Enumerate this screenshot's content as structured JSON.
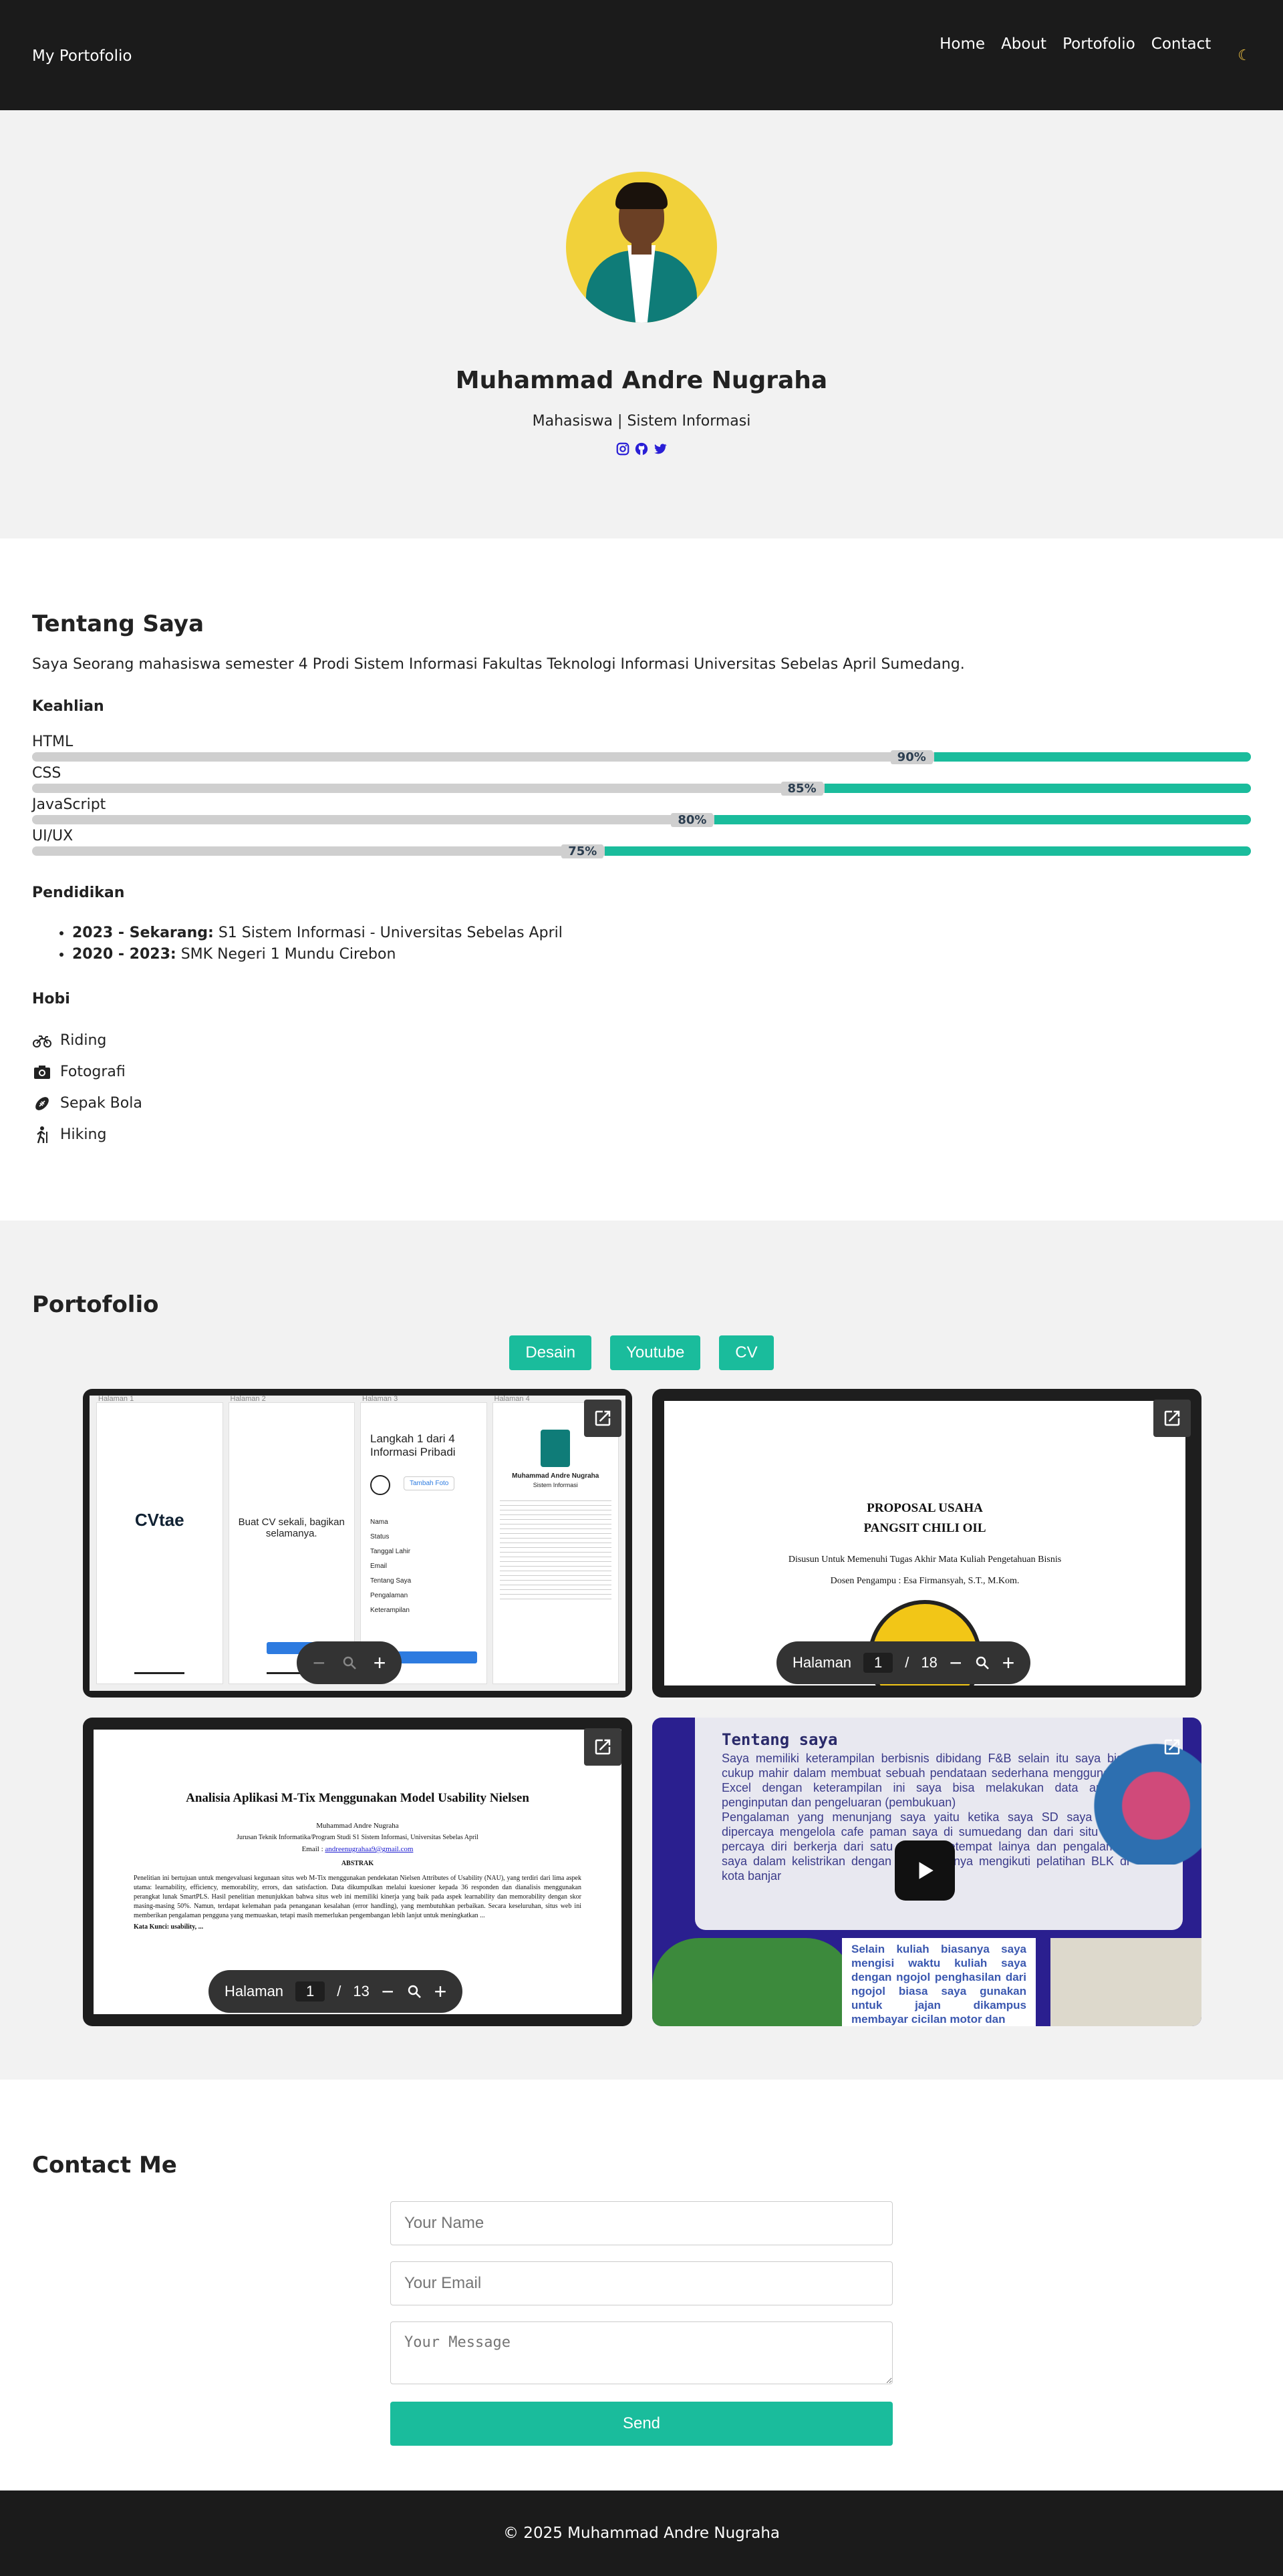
{
  "nav": {
    "brand": "My Portofolio",
    "links": [
      "Home",
      "About",
      "Portofolio",
      "Contact"
    ],
    "theme_icon": "moon-icon"
  },
  "hero": {
    "name": "Muhammad Andre Nugraha",
    "subtitle": "Mahasiswa | Sistem Informasi",
    "social": [
      "instagram-icon",
      "github-icon",
      "twitter-icon"
    ]
  },
  "about": {
    "title": "Tentang Saya",
    "intro": "Saya Seorang mahasiswa semester 4 Prodi Sistem Informasi Fakultas Teknologi Informasi Universitas Sebelas April Sumedang.",
    "skills_title": "Keahlian",
    "skills": [
      {
        "name": "HTML",
        "percent": 90,
        "label": "90%"
      },
      {
        "name": "CSS",
        "percent": 85,
        "label": "85%"
      },
      {
        "name": "JavaScript",
        "percent": 80,
        "label": "80%"
      },
      {
        "name": "UI/UX",
        "percent": 75,
        "label": "75%"
      }
    ],
    "education_title": "Pendidikan",
    "education": [
      {
        "years": "2023 - Sekarang:",
        "text": " S1 Sistem Informasi - Universitas Sebelas April"
      },
      {
        "years": "2020 - 2023:",
        "text": " SMK Negeri 1 Mundu Cirebon"
      }
    ],
    "hobbies_title": "Hobi",
    "hobbies": [
      "Riding",
      "Fotografi",
      "Sepak Bola",
      "Hiking"
    ]
  },
  "portfolio": {
    "title": "Portofolio",
    "filters": [
      "Desain",
      "Youtube",
      "CV"
    ],
    "card1": {
      "pages": [
        "Halaman 1",
        "Halaman 2",
        "Halaman 3",
        "Halaman 4"
      ],
      "logo": "CVtae",
      "tagline": "Buat CV sekali, bagikan selamanya.",
      "step_title": "Langkah 1 dari 4 Informasi Pribadi",
      "add_photo": "Tambah Foto",
      "fields": [
        "Nama",
        "Status",
        "Tanggal Lahir",
        "Email",
        "Tentang Saya",
        "Pengalaman",
        "Keterampilan"
      ],
      "profile_name": "Muhammad Andre Nugraha",
      "profile_role": "Sistem Informasi"
    },
    "card2": {
      "title1": "PROPOSAL USAHA",
      "title2": "PANGSIT CHILI OIL",
      "line1": "Disusun Untuk Memenuhi Tugas Akhir Mata Kuliah Pengetahuan Bisnis",
      "line2": "Dosen Pengampu : Esa Firmansyah, S.T., M.Kom.",
      "pager_label": "Halaman",
      "page": "1",
      "sep": "/",
      "total": "18"
    },
    "card3": {
      "title": "Analisia Aplikasi M-Tix Menggunakan Model Usability Nielsen",
      "author": "Muhammad Andre Nugraha",
      "affiliation": "Jurusan Teknik Informatika/Program Studi S1 Sistem Informasi, Universitas Sebelas April",
      "email_label": "Email : ",
      "email": "andreenugrahaa9@gmail.com",
      "abstract_title": "ABSTRAK",
      "abstract": "Penelitian ini bertujuan untuk mengevaluasi kegunaan situs web M-Tix menggunakan pendekatan Nielsen Attributes of Usability (NAU), yang terdiri dari lima aspek utama: learnability, efficiency, memorability, errors, dan satisfaction. Data dikumpulkan melalui kuesioner kepada 36 responden dan dianalisis menggunakan perangkat lunak SmartPLS. Hasil penelitian menunjukkan bahwa situs web ini memiliki kinerja yang baik pada aspek learnability dan memorability dengan skor masing-masing 50%. Namun, terdapat kelemahan pada penanganan kesalahan (error handling), yang membutuhkan perbaikan. Secara keseluruhan, situs web ini memberikan pengalaman pengguna yang memuaskan, tetapi masih memerlukan pengembangan lebih lanjut untuk meningkatkan ...",
      "keywords": "Kata Kunci: usability, ...",
      "pager_label": "Halaman",
      "page": "1",
      "sep": "/",
      "total": "13"
    },
    "card4": {
      "heading": "Tentang saya",
      "para1": "Saya memiliki keterampilan berbisnis dibidang F&B selain itu saya bisa cukup mahir dalam membuat sebuah pendataan sederhana menggunakan Excel dengan keterampilan ini saya bisa melakukan data analisis penginputan dan pengeluaran (pembukuan)",
      "para2": "Pengalaman yang menunjang saya yaitu ketika saya SD saya mulai dipercaya mengelola cafe paman saya di sumuedang dan dari situ saya percaya diri berkerja dari satu tempat ketempat lainya dan pengalaman saya dalam kelistrikan dengan mengasahnya mengikuti pelatihan BLK di kota banjar",
      "para3": "Selain kuliah biasanya saya mengisi waktu kuliah saya dengan ngojol penghasilan dari ngojol biasa saya gunakan untuk jajan dikampus membayar cicilan motor dan"
    }
  },
  "contact": {
    "title": "Contact Me",
    "name_placeholder": "Your Name",
    "email_placeholder": "Your Email",
    "message_placeholder": "Your Message",
    "send": "Send"
  },
  "footer": {
    "text": "© 2025 Muhammad Andre Nugraha"
  },
  "colors": {
    "accent": "#1abc9c",
    "dark": "#1b1b1b",
    "light_bg": "#f2f2f2",
    "social": "#2a1fd6"
  }
}
